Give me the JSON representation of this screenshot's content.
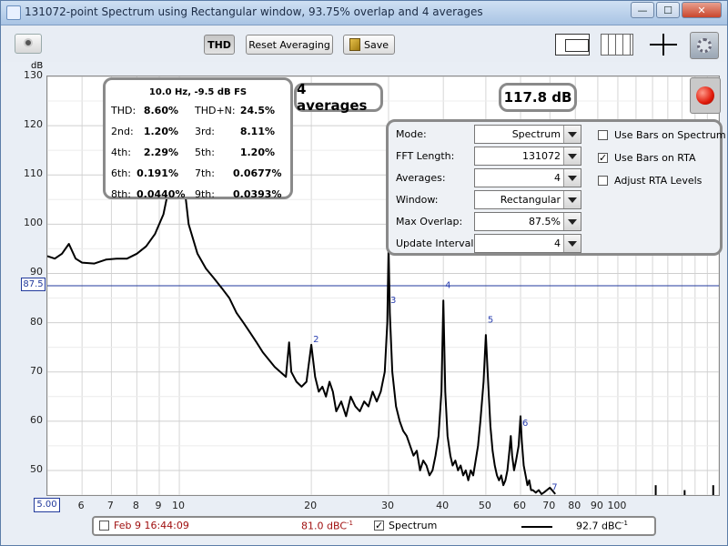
{
  "window": {
    "title": "131072-point Spectrum using Rectangular window, 93.75% overlap and 4 averages",
    "buttons": {
      "minimize": "—",
      "maximize": "☐",
      "close": "✕"
    }
  },
  "toolbar": {
    "thd_label": "THD",
    "reset_label": "Reset Averaging",
    "save_label": "Save"
  },
  "thd": {
    "title": "10.0 Hz, -9.5 dB FS",
    "rows": [
      {
        "l1": "THD:",
        "v1": "8.60%",
        "l2": "THD+N:",
        "v2": "24.5%"
      },
      {
        "l1": "2nd:",
        "v1": "1.20%",
        "l2": "3rd:",
        "v2": "8.11%"
      },
      {
        "l1": "4th:",
        "v1": "2.29%",
        "l2": "5th:",
        "v2": "1.20%"
      },
      {
        "l1": "6th:",
        "v1": "0.191%",
        "l2": "7th:",
        "v2": "0.0677%"
      },
      {
        "l1": "8th:",
        "v1": "0.0440%",
        "l2": "9th:",
        "v2": "0.0393%"
      }
    ]
  },
  "averages_badge": "4 averages",
  "level_badge": "117.8 dB",
  "settings": {
    "rows": [
      {
        "label": "Mode:",
        "value": "Spectrum"
      },
      {
        "label": "FFT Length:",
        "value": "131072"
      },
      {
        "label": "Averages:",
        "value": "4"
      },
      {
        "label": "Window:",
        "value": "Rectangular"
      },
      {
        "label": "Max Overlap:",
        "value": "87.5%"
      },
      {
        "label": "Update Interval:",
        "value": "4"
      }
    ],
    "checks": [
      {
        "label": "Use Bars on Spectrum",
        "checked": false
      },
      {
        "label": "Use Bars on RTA",
        "checked": true
      },
      {
        "label": "Adjust RTA Levels",
        "checked": false
      }
    ]
  },
  "legend": {
    "ref_label": "Feb 9 16:44:09",
    "ref_checked": false,
    "ref_value": "81.0 dBC",
    "ref_unit_sup": "-1",
    "spec_label": "Spectrum",
    "spec_checked": true,
    "spec_value": "92.7 dBC",
    "spec_unit_sup": "-1",
    "ref_color": "#a01010"
  },
  "chart_data": {
    "type": "line",
    "ylabel": "dB",
    "xscale": "log",
    "xlim": [
      5,
      170
    ],
    "ylim": [
      45,
      130
    ],
    "yticks": [
      50,
      60,
      70,
      80,
      90,
      100,
      110,
      120,
      130
    ],
    "xtick_labels": [
      "5.00",
      "6",
      "7",
      "8",
      "9",
      "10",
      "20",
      "30",
      "40",
      "50",
      "60",
      "70",
      "80",
      "90",
      "100"
    ],
    "xtick_values": [
      5,
      6,
      7,
      8,
      9,
      10,
      20,
      30,
      40,
      50,
      60,
      70,
      80,
      90,
      100
    ],
    "y_marker": {
      "value": 87.5,
      "label": "87.5"
    },
    "x_marker_label": "5.00",
    "harmonic_labels": [
      {
        "label": "2",
        "x": 20,
        "y": 76
      },
      {
        "label": "3",
        "x": 30,
        "y": 84
      },
      {
        "label": "4",
        "x": 40,
        "y": 87
      },
      {
        "label": "5",
        "x": 50,
        "y": 80
      },
      {
        "label": "6",
        "x": 60,
        "y": 59
      },
      {
        "label": "7",
        "x": 70,
        "y": 46
      }
    ],
    "series": [
      {
        "points": [
          [
            5.0,
            93.5
          ],
          [
            5.2,
            93.0
          ],
          [
            5.4,
            94.0
          ],
          [
            5.6,
            96.0
          ],
          [
            5.8,
            93.0
          ],
          [
            6.0,
            92.2
          ],
          [
            6.4,
            92.0
          ],
          [
            6.8,
            92.8
          ],
          [
            7.2,
            93.0
          ],
          [
            7.6,
            93.0
          ],
          [
            8.0,
            94.0
          ],
          [
            8.4,
            95.5
          ],
          [
            8.8,
            98.0
          ],
          [
            9.2,
            102
          ],
          [
            9.5,
            108
          ],
          [
            9.8,
            116
          ],
          [
            10.0,
            117
          ],
          [
            10.2,
            110
          ],
          [
            10.5,
            100
          ],
          [
            11.0,
            94
          ],
          [
            11.5,
            91
          ],
          [
            12.0,
            89
          ],
          [
            12.5,
            87
          ],
          [
            13.0,
            85
          ],
          [
            13.5,
            82
          ],
          [
            14.0,
            80
          ],
          [
            14.5,
            78
          ],
          [
            15.0,
            76
          ],
          [
            15.5,
            74
          ],
          [
            16.0,
            72.5
          ],
          [
            16.5,
            71
          ],
          [
            17.0,
            70
          ],
          [
            17.5,
            69
          ],
          [
            17.8,
            76
          ],
          [
            18.0,
            70
          ],
          [
            18.5,
            68
          ],
          [
            19.0,
            67
          ],
          [
            19.5,
            68
          ],
          [
            20.0,
            75.5
          ],
          [
            20.4,
            69
          ],
          [
            20.8,
            66
          ],
          [
            21.2,
            67
          ],
          [
            21.6,
            65
          ],
          [
            22.0,
            68
          ],
          [
            22.4,
            66
          ],
          [
            22.8,
            62
          ],
          [
            23.4,
            64
          ],
          [
            24.0,
            61
          ],
          [
            24.6,
            65
          ],
          [
            25.2,
            63
          ],
          [
            25.8,
            62
          ],
          [
            26.4,
            64
          ],
          [
            27.0,
            63
          ],
          [
            27.6,
            66
          ],
          [
            28.2,
            64
          ],
          [
            28.8,
            66
          ],
          [
            29.4,
            70
          ],
          [
            29.8,
            80
          ],
          [
            30.0,
            95.5
          ],
          [
            30.2,
            82
          ],
          [
            30.6,
            70
          ],
          [
            31.2,
            63
          ],
          [
            31.8,
            60
          ],
          [
            32.4,
            58
          ],
          [
            33.0,
            57
          ],
          [
            33.6,
            55
          ],
          [
            34.2,
            53
          ],
          [
            34.8,
            54
          ],
          [
            35.4,
            50
          ],
          [
            36.0,
            52
          ],
          [
            36.6,
            51
          ],
          [
            37.2,
            49
          ],
          [
            37.8,
            50
          ],
          [
            38.4,
            53
          ],
          [
            39.0,
            57
          ],
          [
            39.6,
            66
          ],
          [
            40.0,
            84.5
          ],
          [
            40.4,
            66
          ],
          [
            40.9,
            57
          ],
          [
            41.5,
            53
          ],
          [
            42.0,
            51
          ],
          [
            42.6,
            52
          ],
          [
            43.2,
            50
          ],
          [
            43.8,
            51
          ],
          [
            44.4,
            49
          ],
          [
            45.0,
            50
          ],
          [
            45.6,
            48
          ],
          [
            46.2,
            50
          ],
          [
            46.8,
            49
          ],
          [
            47.4,
            52
          ],
          [
            48.0,
            55
          ],
          [
            48.6,
            60
          ],
          [
            49.4,
            68
          ],
          [
            50.0,
            77.5
          ],
          [
            50.6,
            68
          ],
          [
            51.2,
            59
          ],
          [
            51.8,
            54
          ],
          [
            52.4,
            51
          ],
          [
            53.0,
            49
          ],
          [
            53.6,
            48
          ],
          [
            54.2,
            49
          ],
          [
            54.8,
            47
          ],
          [
            55.4,
            48
          ],
          [
            56.0,
            50
          ],
          [
            56.6,
            54
          ],
          [
            57.0,
            57
          ],
          [
            57.4,
            53
          ],
          [
            58.0,
            50
          ],
          [
            58.6,
            52
          ],
          [
            59.4,
            55
          ],
          [
            60.0,
            61
          ],
          [
            60.4,
            56
          ],
          [
            61.0,
            51
          ],
          [
            61.6,
            49
          ],
          [
            62.2,
            47
          ],
          [
            62.8,
            48
          ],
          [
            63.4,
            46
          ],
          [
            64.0,
            46
          ],
          [
            65.0,
            45.5
          ],
          [
            66.0,
            46
          ],
          [
            67.0,
            45.2
          ],
          [
            68.0,
            45.6
          ],
          [
            70.0,
            46.5
          ],
          [
            72.0,
            45.2
          ]
        ]
      }
    ],
    "grid": true
  }
}
